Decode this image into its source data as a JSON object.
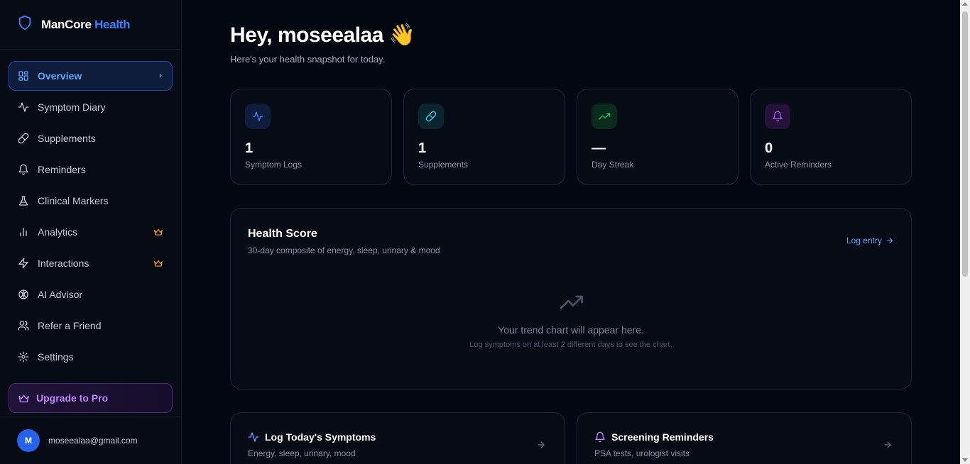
{
  "brand": {
    "name_part1": "ManCore",
    "name_part2": "Health",
    "icon": "shield-icon"
  },
  "sidebar": {
    "items": [
      {
        "label": "Overview",
        "icon": "grid-icon",
        "active": true
      },
      {
        "label": "Symptom Diary",
        "icon": "activity-icon"
      },
      {
        "label": "Supplements",
        "icon": "pill-icon"
      },
      {
        "label": "Reminders",
        "icon": "bell-icon"
      },
      {
        "label": "Clinical Markers",
        "icon": "flask-icon"
      },
      {
        "label": "Analytics",
        "icon": "bar-chart-icon",
        "pro": true
      },
      {
        "label": "Interactions",
        "icon": "zap-icon",
        "pro": true
      },
      {
        "label": "AI Advisor",
        "icon": "brain-icon"
      },
      {
        "label": "Refer a Friend",
        "icon": "users-icon"
      },
      {
        "label": "Settings",
        "icon": "gear-icon"
      }
    ],
    "upgrade_label": "Upgrade to Pro"
  },
  "user": {
    "initial": "M",
    "email": "moseealaa@gmail.com"
  },
  "header": {
    "greeting": "Hey, moseealaa 👋",
    "subtitle": "Here's your health snapshot for today."
  },
  "stats": [
    {
      "value": "1",
      "label": "Symptom Logs",
      "icon": "activity-icon",
      "color": "#3b82f6"
    },
    {
      "value": "1",
      "label": "Supplements",
      "icon": "pill-icon",
      "color": "#22d3ee"
    },
    {
      "value": "—",
      "label": "Day Streak",
      "icon": "trending-up-icon",
      "color": "#22c55e"
    },
    {
      "value": "0",
      "label": "Active Reminders",
      "icon": "bell-icon",
      "color": "#a855f7"
    }
  ],
  "health_score": {
    "title": "Health Score",
    "subtitle": "30-day composite of energy, sleep, urinary & mood",
    "link": "Log entry",
    "empty_title": "Your trend chart will appear here.",
    "empty_subtitle": "Log symptoms on at least 2 different days to see the chart."
  },
  "quick_cards": [
    {
      "title": "Log Today's Symptoms",
      "subtitle": "Energy, sleep, urinary, mood",
      "icon": "activity-icon"
    },
    {
      "title": "Screening Reminders",
      "subtitle": "PSA tests, urologist visits",
      "icon": "bell-icon"
    }
  ],
  "colors": {
    "background": "#030712",
    "accent": "#3b82f6",
    "pro": "#c084fc",
    "crown": "#f59e0b"
  }
}
